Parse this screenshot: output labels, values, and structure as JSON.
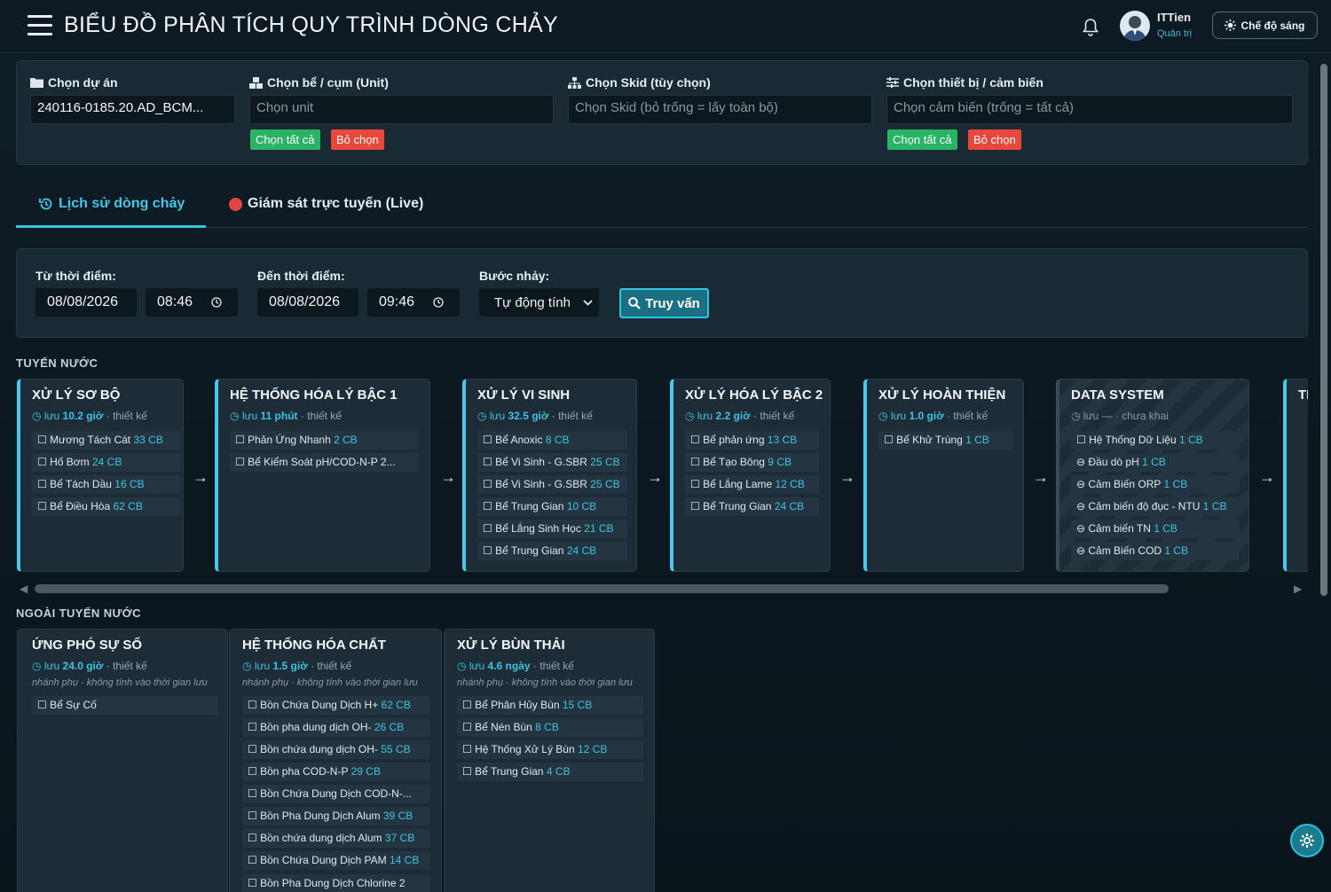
{
  "header": {
    "title": "BIỂU ĐỒ PHÂN TÍCH QUY TRÌNH DÒNG CHẢY",
    "user_name": "ITTien",
    "user_role": "Quản trị",
    "mode_label": "Chế độ sáng"
  },
  "filters": {
    "project": {
      "label": "Chọn dự án",
      "value": "240116-0185.20.AD_BCM..."
    },
    "unit": {
      "label": "Chọn bể / cụm (Unit)",
      "placeholder": "Chọn unit",
      "select_all": "Chọn tất cả",
      "deselect": "Bỏ chọn"
    },
    "skid": {
      "label": "Chọn Skid (tùy chọn)",
      "placeholder": "Chọn Skid (bỏ trống = lấy toàn bộ)"
    },
    "device": {
      "label": "Chọn thiết bị / cảm biến",
      "placeholder": "Chọn cảm biến (trống = tất cả)",
      "select_all": "Chọn tất cả",
      "deselect": "Bỏ chọn"
    }
  },
  "tabs": [
    {
      "label": "Lịch sử dòng chảy",
      "active": true
    },
    {
      "label": "Giám sát trực tuyến (Live)",
      "active": false
    }
  ],
  "query": {
    "from_label": "Từ thời điểm:",
    "from_date": "08/08/2026",
    "from_time": "08:46",
    "to_label": "Đến thời điểm:",
    "to_date": "08/08/2026",
    "to_time": "09:46",
    "step_label": "Bước nhảy:",
    "step_value": "Tự động tính",
    "button": "Truy vấn"
  },
  "section_main": "TUYẾN NƯỚC",
  "section_side": "NGOÀI TUYẾN NƯỚC",
  "meta_prefix": "lưu",
  "meta_design": "· thiết kế",
  "meta_undeployed": "· chưa khai",
  "meta_dash": "—",
  "side_note": "nhánh phụ · không tính vào thời gian lưu",
  "main_cards": [
    {
      "title": "XỬ LÝ SƠ BỘ",
      "time": "10.2 giờ",
      "items": [
        {
          "name": "Mương Tách Cát",
          "count": "33 CB"
        },
        {
          "name": "Hố Bơm",
          "count": "24 CB"
        },
        {
          "name": "Bể Tách Dầu",
          "count": "16 CB"
        },
        {
          "name": "Bể Điều Hòa",
          "count": "62 CB"
        }
      ]
    },
    {
      "title": "HỆ THỐNG HÓA LÝ BẬC 1",
      "time": "11 phút",
      "items": [
        {
          "name": "Phản Ứng Nhanh",
          "count": "2 CB"
        },
        {
          "name": "Bể Kiểm Soát pH/COD-N-P 2...",
          "count": ""
        }
      ]
    },
    {
      "title": "XỬ LÝ VI SINH",
      "time": "32.5 giờ",
      "items": [
        {
          "name": "Bể Anoxic",
          "count": "8 CB"
        },
        {
          "name": "Bể Vi Sinh - G.SBR",
          "count": "25 CB"
        },
        {
          "name": "Bể Vi Sinh - G.SBR",
          "count": "25 CB"
        },
        {
          "name": "Bể Trung Gian",
          "count": "10 CB"
        },
        {
          "name": "Bể Lắng Sinh Học",
          "count": "21 CB"
        },
        {
          "name": "Bể Trung Gian",
          "count": "24 CB"
        }
      ]
    },
    {
      "title": "XỬ LÝ HÓA LÝ BẬC 2",
      "time": "2.2 giờ",
      "items": [
        {
          "name": "Bể phản ứng",
          "count": "13 CB"
        },
        {
          "name": "Bể Tạo Bông",
          "count": "9 CB"
        },
        {
          "name": "Bể Lắng Lame",
          "count": "12 CB"
        },
        {
          "name": "Bể Trung Gian",
          "count": "24 CB"
        }
      ]
    },
    {
      "title": "XỬ LÝ HOÀN THIỆN",
      "time": "1.0 giờ",
      "items": [
        {
          "name": "Bể Khử Trùng",
          "count": "1 CB"
        }
      ]
    },
    {
      "title": "DATA SYSTEM",
      "items": [
        {
          "name": "Hệ Thống Dữ Liệu",
          "count": "1 CB"
        },
        {
          "name": "Đầu dò pH",
          "count": "1 CB"
        },
        {
          "name": "Cảm Biến ORP",
          "count": "1 CB"
        },
        {
          "name": "Cảm biến độ đục - NTU",
          "count": "1 CB"
        },
        {
          "name": "Cảm biến TN",
          "count": "1 CB"
        },
        {
          "name": "Cảm Biến COD",
          "count": "1 CB"
        }
      ]
    },
    {
      "title": "TI"
    }
  ],
  "side_cards": [
    {
      "title": "ỨNG PHÓ SỰ SỐ",
      "time": "24.0 giờ",
      "items": [
        {
          "name": "Bể Sự Cố",
          "count": ""
        }
      ]
    },
    {
      "title": "HỆ THỐNG HÓA CHẤT",
      "time": "1.5 giờ",
      "items": [
        {
          "name": "Bồn Chứa Dung Dịch H+",
          "count": "62 CB"
        },
        {
          "name": "Bồn pha dung dịch OH-",
          "count": "26 CB"
        },
        {
          "name": "Bồn chứa dung dịch OH-",
          "count": "55 CB"
        },
        {
          "name": "Bồn pha COD-N-P",
          "count": "29 CB"
        },
        {
          "name": "Bồn Chứa Dung Dịch COD-N-...",
          "count": ""
        },
        {
          "name": "Bồn Pha Dung Dịch Alum",
          "count": "39 CB"
        },
        {
          "name": "Bồn chứa dung dịch Alum",
          "count": "37 CB"
        },
        {
          "name": "Bồn Chứa Dung Dịch PAM",
          "count": "14 CB"
        },
        {
          "name": "Bồn Pha Dung Dịch Chlorine 2",
          "count": ""
        }
      ]
    },
    {
      "title": "XỬ LÝ BÙN THẢI",
      "time": "4.6 ngày",
      "items": [
        {
          "name": "Bể Phân Hủy Bùn",
          "count": "15 CB"
        },
        {
          "name": "Bể Nén Bùn",
          "count": "8 CB"
        },
        {
          "name": "Hệ Thống Xử Lý Bùn",
          "count": "12 CB"
        },
        {
          "name": "Bể Trung Gian",
          "count": "4 CB"
        }
      ]
    }
  ],
  "colors": {
    "accent": "#48c9ec",
    "success": "#28b463",
    "danger": "#e8473c",
    "live": "#e04545"
  }
}
